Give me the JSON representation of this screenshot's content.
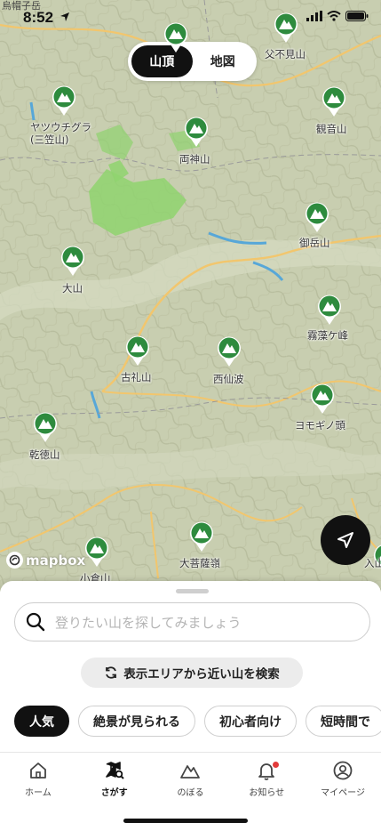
{
  "status_bar": {
    "time": "8:52"
  },
  "map": {
    "corner_label": "烏帽子岳",
    "toggle": {
      "summit_label": "山頂",
      "map_label": "地図",
      "selected": "山頂"
    },
    "attribution": "mapbox",
    "colors": {
      "marker": "#2e8b3e",
      "forest": "#8fd36f",
      "road": "#f2c66d",
      "water": "#57a7d8"
    },
    "mountains": [
      {
        "name": "ヤツウチグラ\n(三笠山)"
      },
      {
        "name": "両神山"
      },
      {
        "name": "父不見山"
      },
      {
        "name": "観音山"
      },
      {
        "name": "御岳山"
      },
      {
        "name": "大山"
      },
      {
        "name": "霧藻ケ峰"
      },
      {
        "name": "古礼山"
      },
      {
        "name": "西仙波"
      },
      {
        "name": "ヨモギノ頭"
      },
      {
        "name": "乾徳山"
      },
      {
        "name": "大菩薩嶺"
      },
      {
        "name": "小倉山"
      },
      {
        "name": "入山"
      }
    ]
  },
  "sheet": {
    "search_placeholder": "登りたい山を探してみましょう",
    "nearby_button": "表示エリアから近い山を検索",
    "filters": [
      {
        "label": "人気",
        "active": true
      },
      {
        "label": "絶景が見られる",
        "active": false
      },
      {
        "label": "初心者向け",
        "active": false
      },
      {
        "label": "短時間で",
        "active": false
      }
    ]
  },
  "tabbar": {
    "items": [
      {
        "label": "ホーム",
        "icon": "home-icon"
      },
      {
        "label": "さがす",
        "icon": "map-search-icon",
        "active": true
      },
      {
        "label": "のぼる",
        "icon": "mountain-icon"
      },
      {
        "label": "お知らせ",
        "icon": "bell-icon",
        "badge": true
      },
      {
        "label": "マイページ",
        "icon": "person-icon"
      }
    ]
  }
}
